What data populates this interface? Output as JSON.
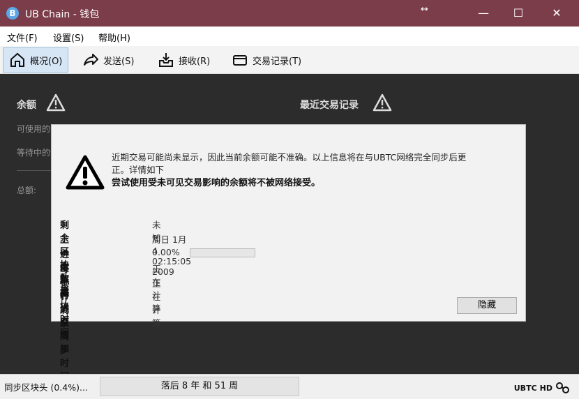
{
  "window": {
    "title": "UB Chain - 钱包",
    "app_icon_glyph": "B",
    "resize_hint": "↔",
    "minimize": "—",
    "maximize": "☐",
    "close": "✕"
  },
  "menu": {
    "file": "文件(F)",
    "settings": "设置(S)",
    "help": "帮助(H)"
  },
  "toolbar": {
    "overview": "概况(O)",
    "send": "发送(S)",
    "receive": "接收(R)",
    "transactions": "交易记录(T)"
  },
  "overview": {
    "balance_label": "余额",
    "available_label": "可使用的余额",
    "pending_label": "等待中的余额",
    "total_label": "总额:",
    "recent_tx_label": "最近交易记录"
  },
  "modal": {
    "message_line1": "近期交易可能尚未显示，因此当前余额可能不准确。以上信息将在与UBTC网络完全同步后更",
    "message_line2": "正。详情如下",
    "message_bold": "尝试使用受未可见交易影响的余额将不被网络接受。",
    "rows": [
      {
        "key": "剩余区块数量",
        "value": "未知"
      },
      {
        "key": "上一个数据块时间",
        "value": "周日 1月 4 02:15:05 2009"
      },
      {
        "key": "进度",
        "value": "0.00%"
      },
      {
        "key": "每小时进度增加",
        "value": "正在计算"
      },
      {
        "key": "预计剩余同步时间",
        "value": "正在计算"
      }
    ],
    "progress_fraction": 0.0,
    "hide_button": "隐藏"
  },
  "statusbar": {
    "sync_text": "同步区块头 (0.4%)...",
    "behind_text": "落后 8 年 和 51 周",
    "unit": "UBTC",
    "hd": "HD"
  },
  "colors": {
    "titlebar": "#7b3d4a",
    "content_bg": "#2c2c2c",
    "progress_fill": "#3a8ed8"
  }
}
